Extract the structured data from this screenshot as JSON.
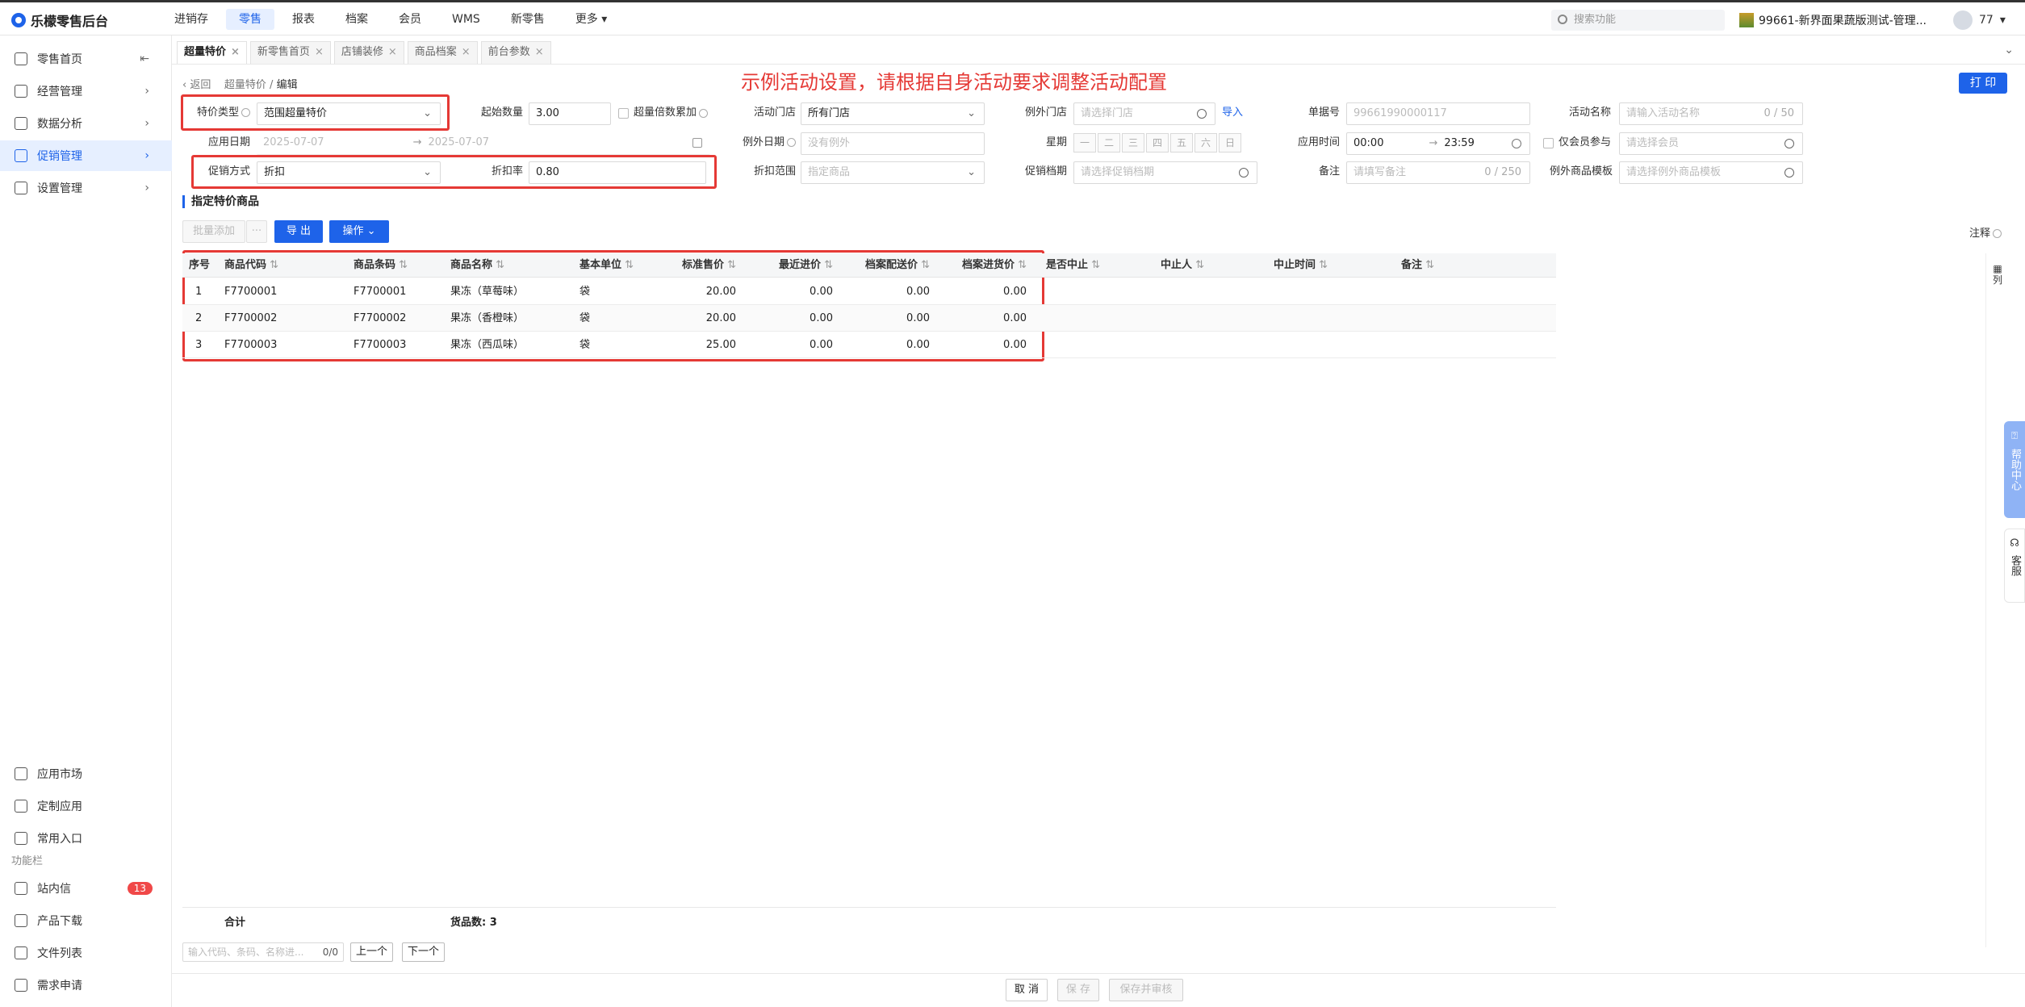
{
  "app": {
    "title": "乐檬零售后台",
    "avatar_count": "77"
  },
  "topnav": [
    "进销存",
    "零售",
    "报表",
    "档案",
    "会员",
    "WMS",
    "新零售",
    "更多"
  ],
  "topnav_active": 1,
  "search": {
    "placeholder": "搜索功能"
  },
  "store": {
    "name": "99661-新界面果蔬版测试-管理..."
  },
  "sidebar": {
    "items": [
      {
        "label": "零售首页",
        "icon": "home-icon"
      },
      {
        "label": "经营管理",
        "icon": "monitor-icon"
      },
      {
        "label": "数据分析",
        "icon": "chart-icon"
      },
      {
        "label": "促销管理",
        "icon": "promotion-icon"
      },
      {
        "label": "设置管理",
        "icon": "settings-icon"
      }
    ],
    "bottom_items": [
      {
        "label": "应用市场",
        "icon": "app-market-icon"
      },
      {
        "label": "定制应用",
        "icon": "custom-app-icon"
      },
      {
        "label": "常用入口",
        "icon": "heart-icon"
      }
    ],
    "section_label": "功能栏",
    "func_items": [
      {
        "label": "站内信",
        "icon": "mail-icon",
        "badge": "13"
      },
      {
        "label": "产品下载",
        "icon": "download-icon"
      },
      {
        "label": "文件列表",
        "icon": "file-list-icon"
      },
      {
        "label": "需求申请",
        "icon": "request-icon"
      }
    ]
  },
  "tabs": [
    {
      "label": "超量特价",
      "active": true
    },
    {
      "label": "新零售首页"
    },
    {
      "label": "店铺装修"
    },
    {
      "label": "商品档案"
    },
    {
      "label": "前台参数"
    }
  ],
  "breadcrumb": {
    "back": "返回",
    "parent": "超量特价",
    "current": "编辑"
  },
  "banner": "示例活动设置，请根据自身活动要求调整活动配置",
  "print_label": "打 印",
  "form": {
    "promo_type": {
      "label": "特价类型",
      "value": "范围超量特价"
    },
    "start_qty": {
      "label": "起始数量",
      "value": "3.00"
    },
    "accumulate": {
      "label": "超量倍数累加"
    },
    "activity_store": {
      "label": "活动门店",
      "value": "所有门店"
    },
    "exception_store": {
      "label": "例外门店",
      "placeholder": "请选择门店",
      "import": "导入"
    },
    "doc_no": {
      "label": "单据号",
      "value": "99661990000117"
    },
    "activity_name": {
      "label": "活动名称",
      "placeholder": "请输入活动名称",
      "count": "0 / 50"
    },
    "apply_date": {
      "label": "应用日期",
      "start": "2025-07-07",
      "end": "2025-07-07"
    },
    "exception_date": {
      "label": "例外日期",
      "placeholder": "没有例外"
    },
    "weekday": {
      "label": "星期",
      "days": [
        "一",
        "二",
        "三",
        "四",
        "五",
        "六",
        "日"
      ]
    },
    "apply_time": {
      "label": "应用时间",
      "start": "00:00",
      "end": "23:59"
    },
    "member_only": {
      "label": "仅会员参与",
      "placeholder": "请选择会员"
    },
    "promo_method": {
      "label": "促销方式",
      "value": "折扣"
    },
    "discount_rate": {
      "label": "折扣率",
      "value": "0.80"
    },
    "discount_range": {
      "label": "折扣范围",
      "value": "指定商品"
    },
    "promo_schedule": {
      "label": "促销档期",
      "placeholder": "请选择促销档期"
    },
    "remark": {
      "label": "备注",
      "placeholder": "请填写备注",
      "count": "0 / 250"
    },
    "exception_template": {
      "label": "例外商品模板",
      "placeholder": "请选择例外商品模板"
    }
  },
  "section_title": "指定特价商品",
  "toolbar": {
    "batch_add": "批量添加",
    "more": "···",
    "export": "导 出",
    "operate": "操作",
    "note": "注释"
  },
  "table": {
    "headers": [
      "序号",
      "商品代码",
      "商品条码",
      "商品名称",
      "基本单位",
      "标准售价",
      "最近进价",
      "档案配送价",
      "档案进货价",
      "是否中止",
      "中止人",
      "中止时间",
      "备注"
    ],
    "rows": [
      [
        "1",
        "F7700001",
        "F7700001",
        "果冻（草莓味）",
        "袋",
        "20.00",
        "0.00",
        "0.00",
        "0.00"
      ],
      [
        "2",
        "F7700002",
        "F7700002",
        "果冻（香橙味）",
        "袋",
        "20.00",
        "0.00",
        "0.00",
        "0.00"
      ],
      [
        "3",
        "F7700003",
        "F7700003",
        "果冻（西瓜味）",
        "袋",
        "25.00",
        "0.00",
        "0.00",
        "0.00"
      ]
    ],
    "col_toggle": "列"
  },
  "footer": {
    "total_label": "合计",
    "goods_count": "货品数: 3",
    "search_placeholder": "输入代码、条码、名称进...",
    "match": "0/0",
    "prev": "上一个",
    "next": "下一个"
  },
  "actions": {
    "cancel": "取 消",
    "save": "保 存",
    "save_audit": "保存并审核"
  },
  "side_float": {
    "help": "帮助中心",
    "service": "客服"
  },
  "colors": {
    "primary": "#1e63e9",
    "highlight": "#e53935"
  }
}
